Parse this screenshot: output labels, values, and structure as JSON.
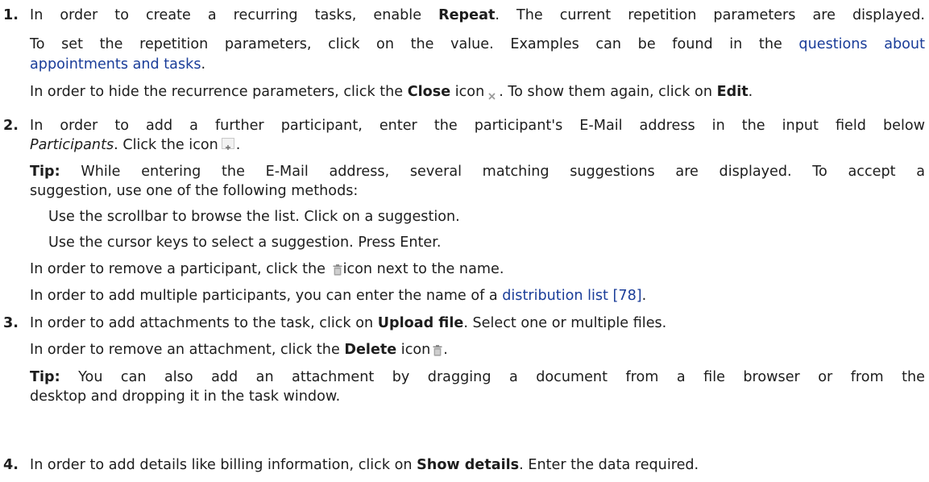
{
  "steps": [
    {
      "number": "1.",
      "l1_pre": "In order to create a recurring tasks, enable ",
      "l1_bold": "Repeat",
      "l1_post": ". The current repetition parameters are displayed.",
      "l2_pre": "To set the repetition parameters, click on the value. Examples can be found in the ",
      "l2_link": "questions about",
      "l3_link": "appointments and tasks",
      "l3_post": ".",
      "l4_pre": "In order to hide the recurrence parameters, click the ",
      "l4_bold1": "Close",
      "l4_mid1": " icon",
      "l4_mid2": ". To show them again, click on ",
      "l4_bold2": "Edit",
      "l4_post": "."
    },
    {
      "number": "2.",
      "l1": "In order to add a further participant, enter the participant's E-Mail address in the input field below",
      "l2_italic": "Participants",
      "l2_mid": ". Click the icon",
      "l2_post": ".",
      "tip_label": "Tip:",
      "tip_l1": " While entering the E-Mail address, several matching suggestions are displayed. To accept a",
      "tip_l2": "suggestion, use one of the following methods:",
      "method1": "Use the scrollbar to browse the list. Click on a suggestion.",
      "method2": "Use the cursor keys to select a suggestion. Press Enter.",
      "remove_pre": "In order to remove a participant, click the ",
      "remove_post": "icon next to the name.",
      "multi_pre": "In order to add multiple participants, you can enter the name of a ",
      "multi_link": "distribution list [78]",
      "multi_post": "."
    },
    {
      "number": "3.",
      "l1_pre": "In order to add attachments to the task, click on ",
      "l1_bold": "Upload file",
      "l1_post": ". Select one or multiple files.",
      "l2_pre": "In order to remove an attachment, click the ",
      "l2_bold": "Delete",
      "l2_mid": " icon",
      "l2_post": ".",
      "tip_label": "Tip:",
      "tip_l1": " You can also add an attachment by dragging a document from a file browser or from the",
      "tip_l2": "desktop and dropping it in the task window."
    },
    {
      "number": "4.",
      "l1_pre": "In order to add details like billing information, click on ",
      "l1_bold": "Show details",
      "l1_post": ". Enter the data required."
    }
  ],
  "icons": {
    "close": "close-icon",
    "add": "add-participant-icon",
    "trash": "trash-icon",
    "delete": "delete-icon"
  },
  "colors": {
    "text": "#1d1d1d",
    "link": "#1a3d99",
    "icon_gray": "#9a9a9a"
  }
}
